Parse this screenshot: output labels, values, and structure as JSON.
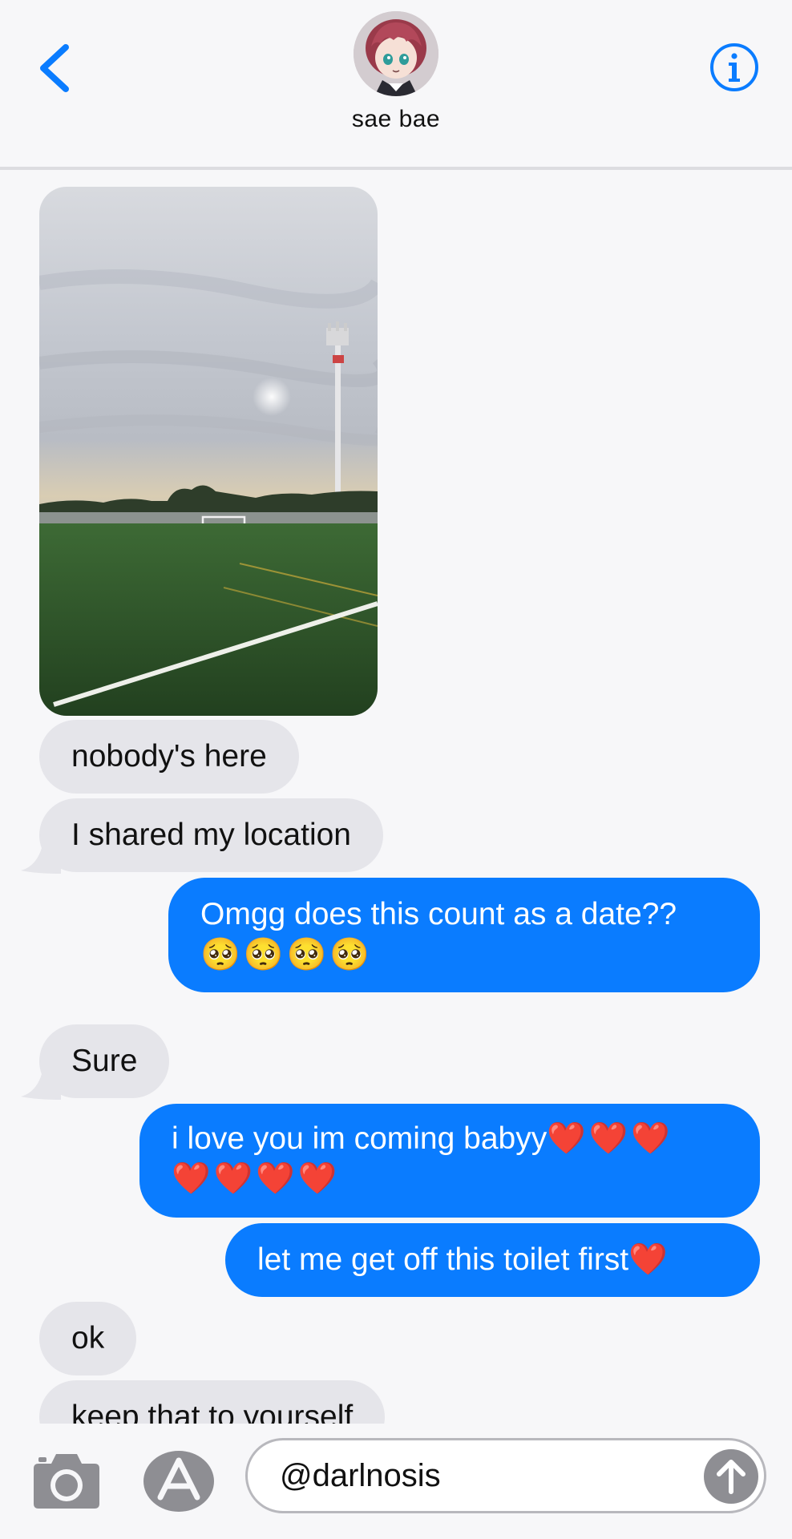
{
  "header": {
    "contact_name": "sae bae",
    "avatar_icon": "anime-avatar",
    "back_icon": "chevron-left-icon",
    "info_icon": "info-icon"
  },
  "messages": [
    {
      "type": "photo",
      "from": "them",
      "subject": "soccer-field-photo"
    },
    {
      "type": "text",
      "from": "them",
      "text": "nobody's here"
    },
    {
      "type": "text",
      "from": "them",
      "text": "I shared my location"
    },
    {
      "type": "text",
      "from": "me",
      "line1": "Omgg does this count as a date??",
      "emojis": "🥺🥺🥺🥺"
    },
    {
      "type": "text",
      "from": "them",
      "text": "Sure"
    },
    {
      "type": "text",
      "from": "me",
      "line1": "i love you im coming babyy",
      "line1_emojis": "❤️❤️❤️",
      "line2_emojis": "❤️❤️❤️❤️"
    },
    {
      "type": "text",
      "from": "me",
      "text": "let me get off this toilet first",
      "emoji": "❤️"
    },
    {
      "type": "text",
      "from": "them",
      "text": "ok"
    },
    {
      "type": "text",
      "from": "them",
      "text": "keep that to yourself"
    }
  ],
  "input_bar": {
    "camera_icon": "camera-icon",
    "apps_icon": "app-store-icon",
    "field_value": "@darlnosis",
    "send_icon": "send-arrow-icon"
  },
  "colors": {
    "sent_bubble": "#0a7cff",
    "received_bubble": "#e5e5ea",
    "accent": "#0a7cff",
    "background": "#f7f7f9"
  }
}
